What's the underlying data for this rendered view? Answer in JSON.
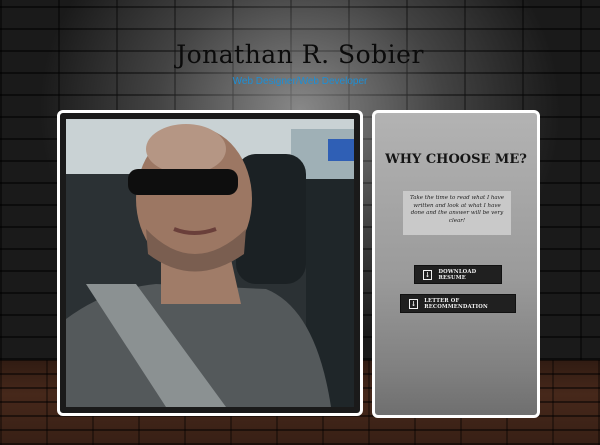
{
  "header": {
    "title": "Jonathan R. Sobier",
    "subtitle": "Web Designer/Web Developer"
  },
  "photo": {
    "alt": "profile-photo"
  },
  "info": {
    "heading": "WHY CHOOSE ME?",
    "blurb": "Take the time to read what I have written and look at what I have done and the answer will be very clear!",
    "buttons": {
      "resume_label": "Download Resume",
      "letter_label": "Letter of Recommendation",
      "icon": "download-icon"
    }
  },
  "colors": {
    "subtitle": "#1c8fd6",
    "card_border": "#ffffff",
    "button_bg": "#202020"
  }
}
